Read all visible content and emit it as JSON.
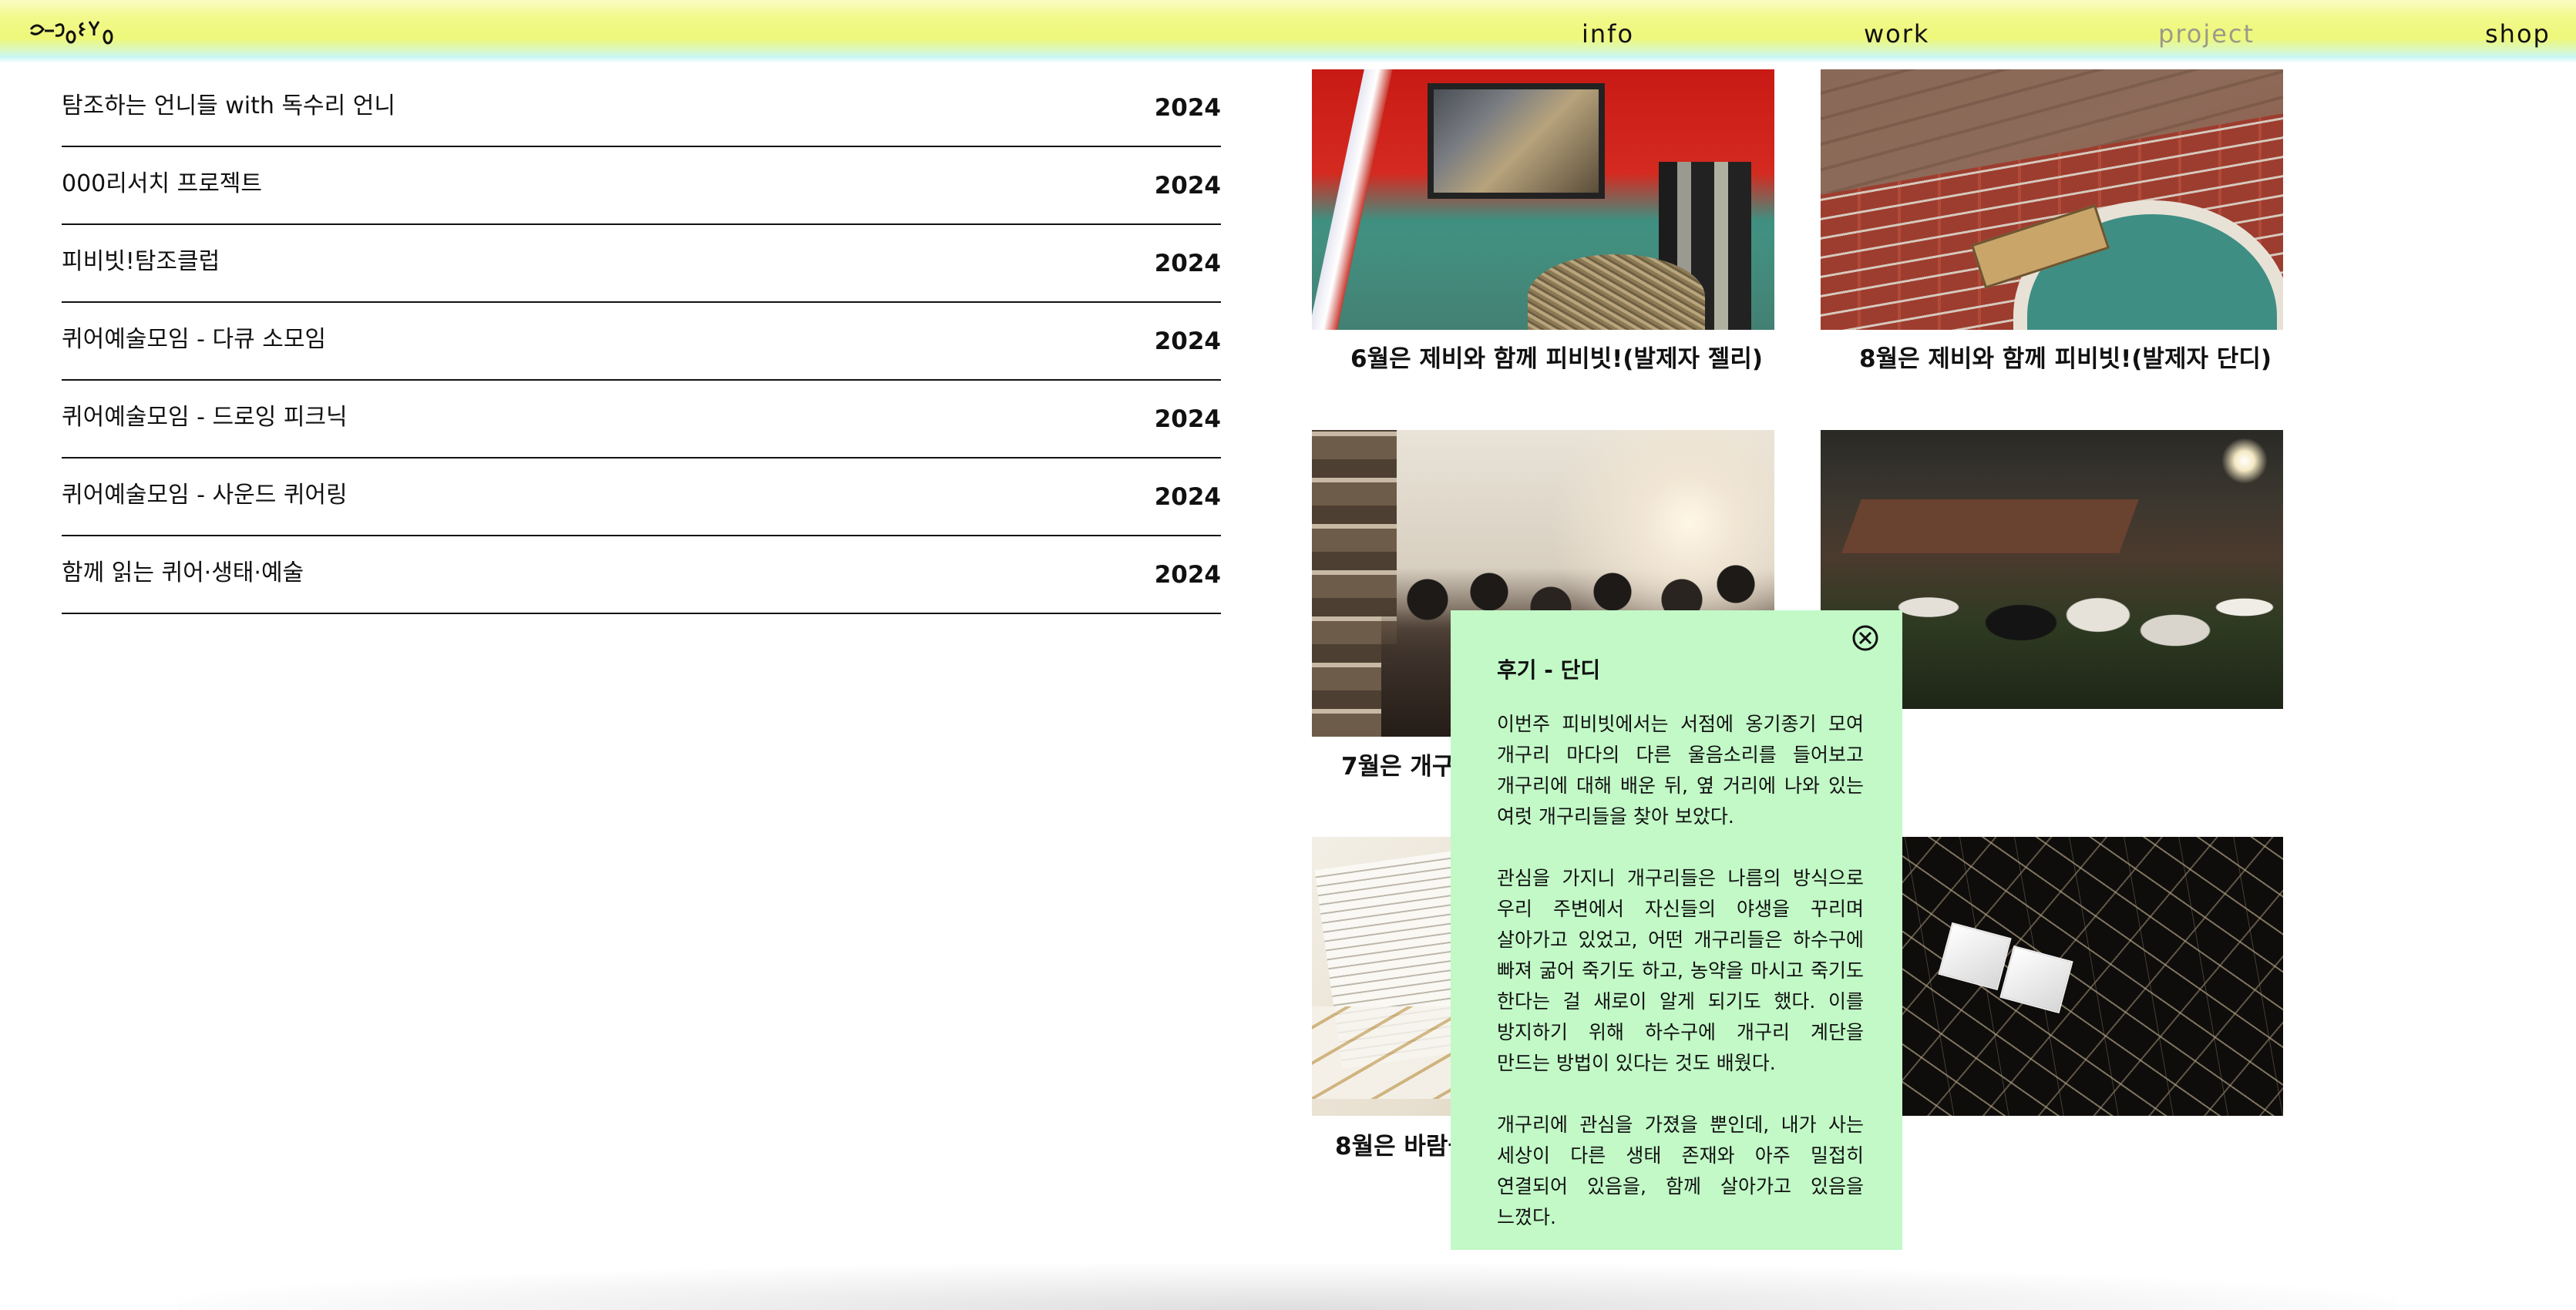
{
  "header": {
    "logo_icon": "squiggle-logo",
    "nav": {
      "info": "info",
      "work": "work",
      "project": "project",
      "shop": "shop"
    },
    "active_nav": "project",
    "colors": {
      "bar": "#eef87a",
      "inactive_text": "#9a9a8a"
    }
  },
  "projects": [
    {
      "title": "탐조하는 언니들 with 독수리 언니",
      "year": "2024"
    },
    {
      "title": "000리서치 프로젝트",
      "year": "2024"
    },
    {
      "title": "피비빗!탐조클럽",
      "year": "2024"
    },
    {
      "title": "퀴어예술모임 - 다큐 소모임",
      "year": "2024"
    },
    {
      "title": "퀴어예술모임 - 드로잉 피크닉",
      "year": "2024"
    },
    {
      "title": "퀴어예술모임 - 사운드 퀴어링",
      "year": "2024"
    },
    {
      "title": "함께 읽는 퀴어·생태·예술",
      "year": "2024"
    }
  ],
  "gallery": {
    "items": [
      {
        "caption": "6월은 제비와 함께 피비빗!(발제자 젤리)"
      },
      {
        "caption": "8월은 제비와 함께 피비빗!(발제자 단디)"
      },
      {
        "caption": "7월은 개구리"
      },
      {
        "caption": ""
      },
      {
        "caption": "8월은 바람을"
      },
      {
        "caption": ""
      }
    ]
  },
  "modal": {
    "title": "후기 - 단디",
    "close_icon": "circle-x-icon",
    "background": "#c2f9c7",
    "paragraphs": [
      "이번주 피비빗에서는 서점에 옹기종기 모여 개구리 마다의 다른 울음소리를 들어보고 개구리에 대해 배운 뒤, 옆 거리에 나와 있는 여럿 개구리들을 찾아 보았다.",
      "관심을 가지니 개구리들은 나름의 방식으로 우리 주변에서 자신들의 야생을 꾸리며 살아가고 있었고, 어떤 개구리들은 하수구에 빠져 굶어 죽기도 하고, 농약을 마시고 죽기도 한다는 걸 새로이 알게 되기도 했다. 이를 방지하기 위해 하수구에 개구리 계단을 만드는 방법이 있다는 것도 배웠다.",
      "개구리에 관심을 가졌을 뿐인데, 내가 사는 세상이 다른 생태 존재와 아주 밀접히 연결되어 있음을, 함께 살아가고 있음을 느꼈다."
    ]
  }
}
